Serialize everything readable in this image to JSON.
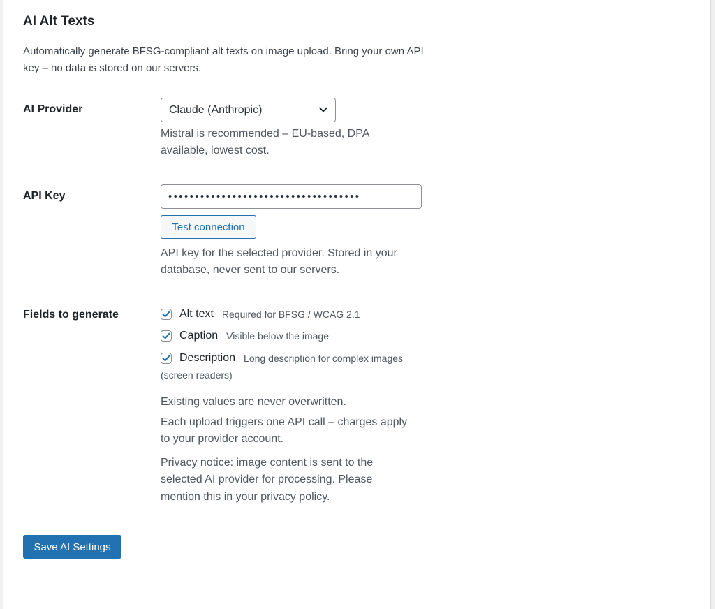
{
  "section": {
    "title": "AI Alt Texts",
    "intro": "Automatically generate BFSG-compliant alt texts on image upload. Bring your own API key – no data is stored on our servers."
  },
  "provider": {
    "label": "AI Provider",
    "selected": "Claude (Anthropic)",
    "description_line1": "Mistral is recommended – EU-based, DPA",
    "description_line2": "available, lowest cost."
  },
  "api_key": {
    "label": "API Key",
    "masked_value": "••••••••••••••••••••••••••••••••••••",
    "test_button": "Test connection",
    "description_line1": "API key for the selected provider. Stored in your",
    "description_line2": "database, never sent to our servers."
  },
  "fields": {
    "label": "Fields to generate",
    "options": [
      {
        "label": "Alt text",
        "hint": "Required for BFSG / WCAG 2.1",
        "checked": true
      },
      {
        "label": "Caption",
        "hint": "Visible below the image",
        "checked": true
      },
      {
        "label": "Description",
        "hint": "Long description for complex images",
        "checked": true
      }
    ],
    "description_hint_wrap": "(screen readers)",
    "note_existing": "Existing values are never overwritten.",
    "note_cost_line1": "Each upload triggers one API call – charges apply",
    "note_cost_line2": "to your provider account.",
    "note_privacy_line1": "Privacy notice: image content is sent to the",
    "note_privacy_line2": "selected AI provider for processing. Please",
    "note_privacy_line3": "mention this in your privacy policy."
  },
  "actions": {
    "save_label": "Save AI Settings"
  },
  "colors": {
    "accent": "#2271b1",
    "text": "#1d2327",
    "muted": "#50575e"
  },
  "icons": {
    "select_arrow": "chevron-down-icon",
    "checkbox_mark": "checkmark-icon"
  }
}
